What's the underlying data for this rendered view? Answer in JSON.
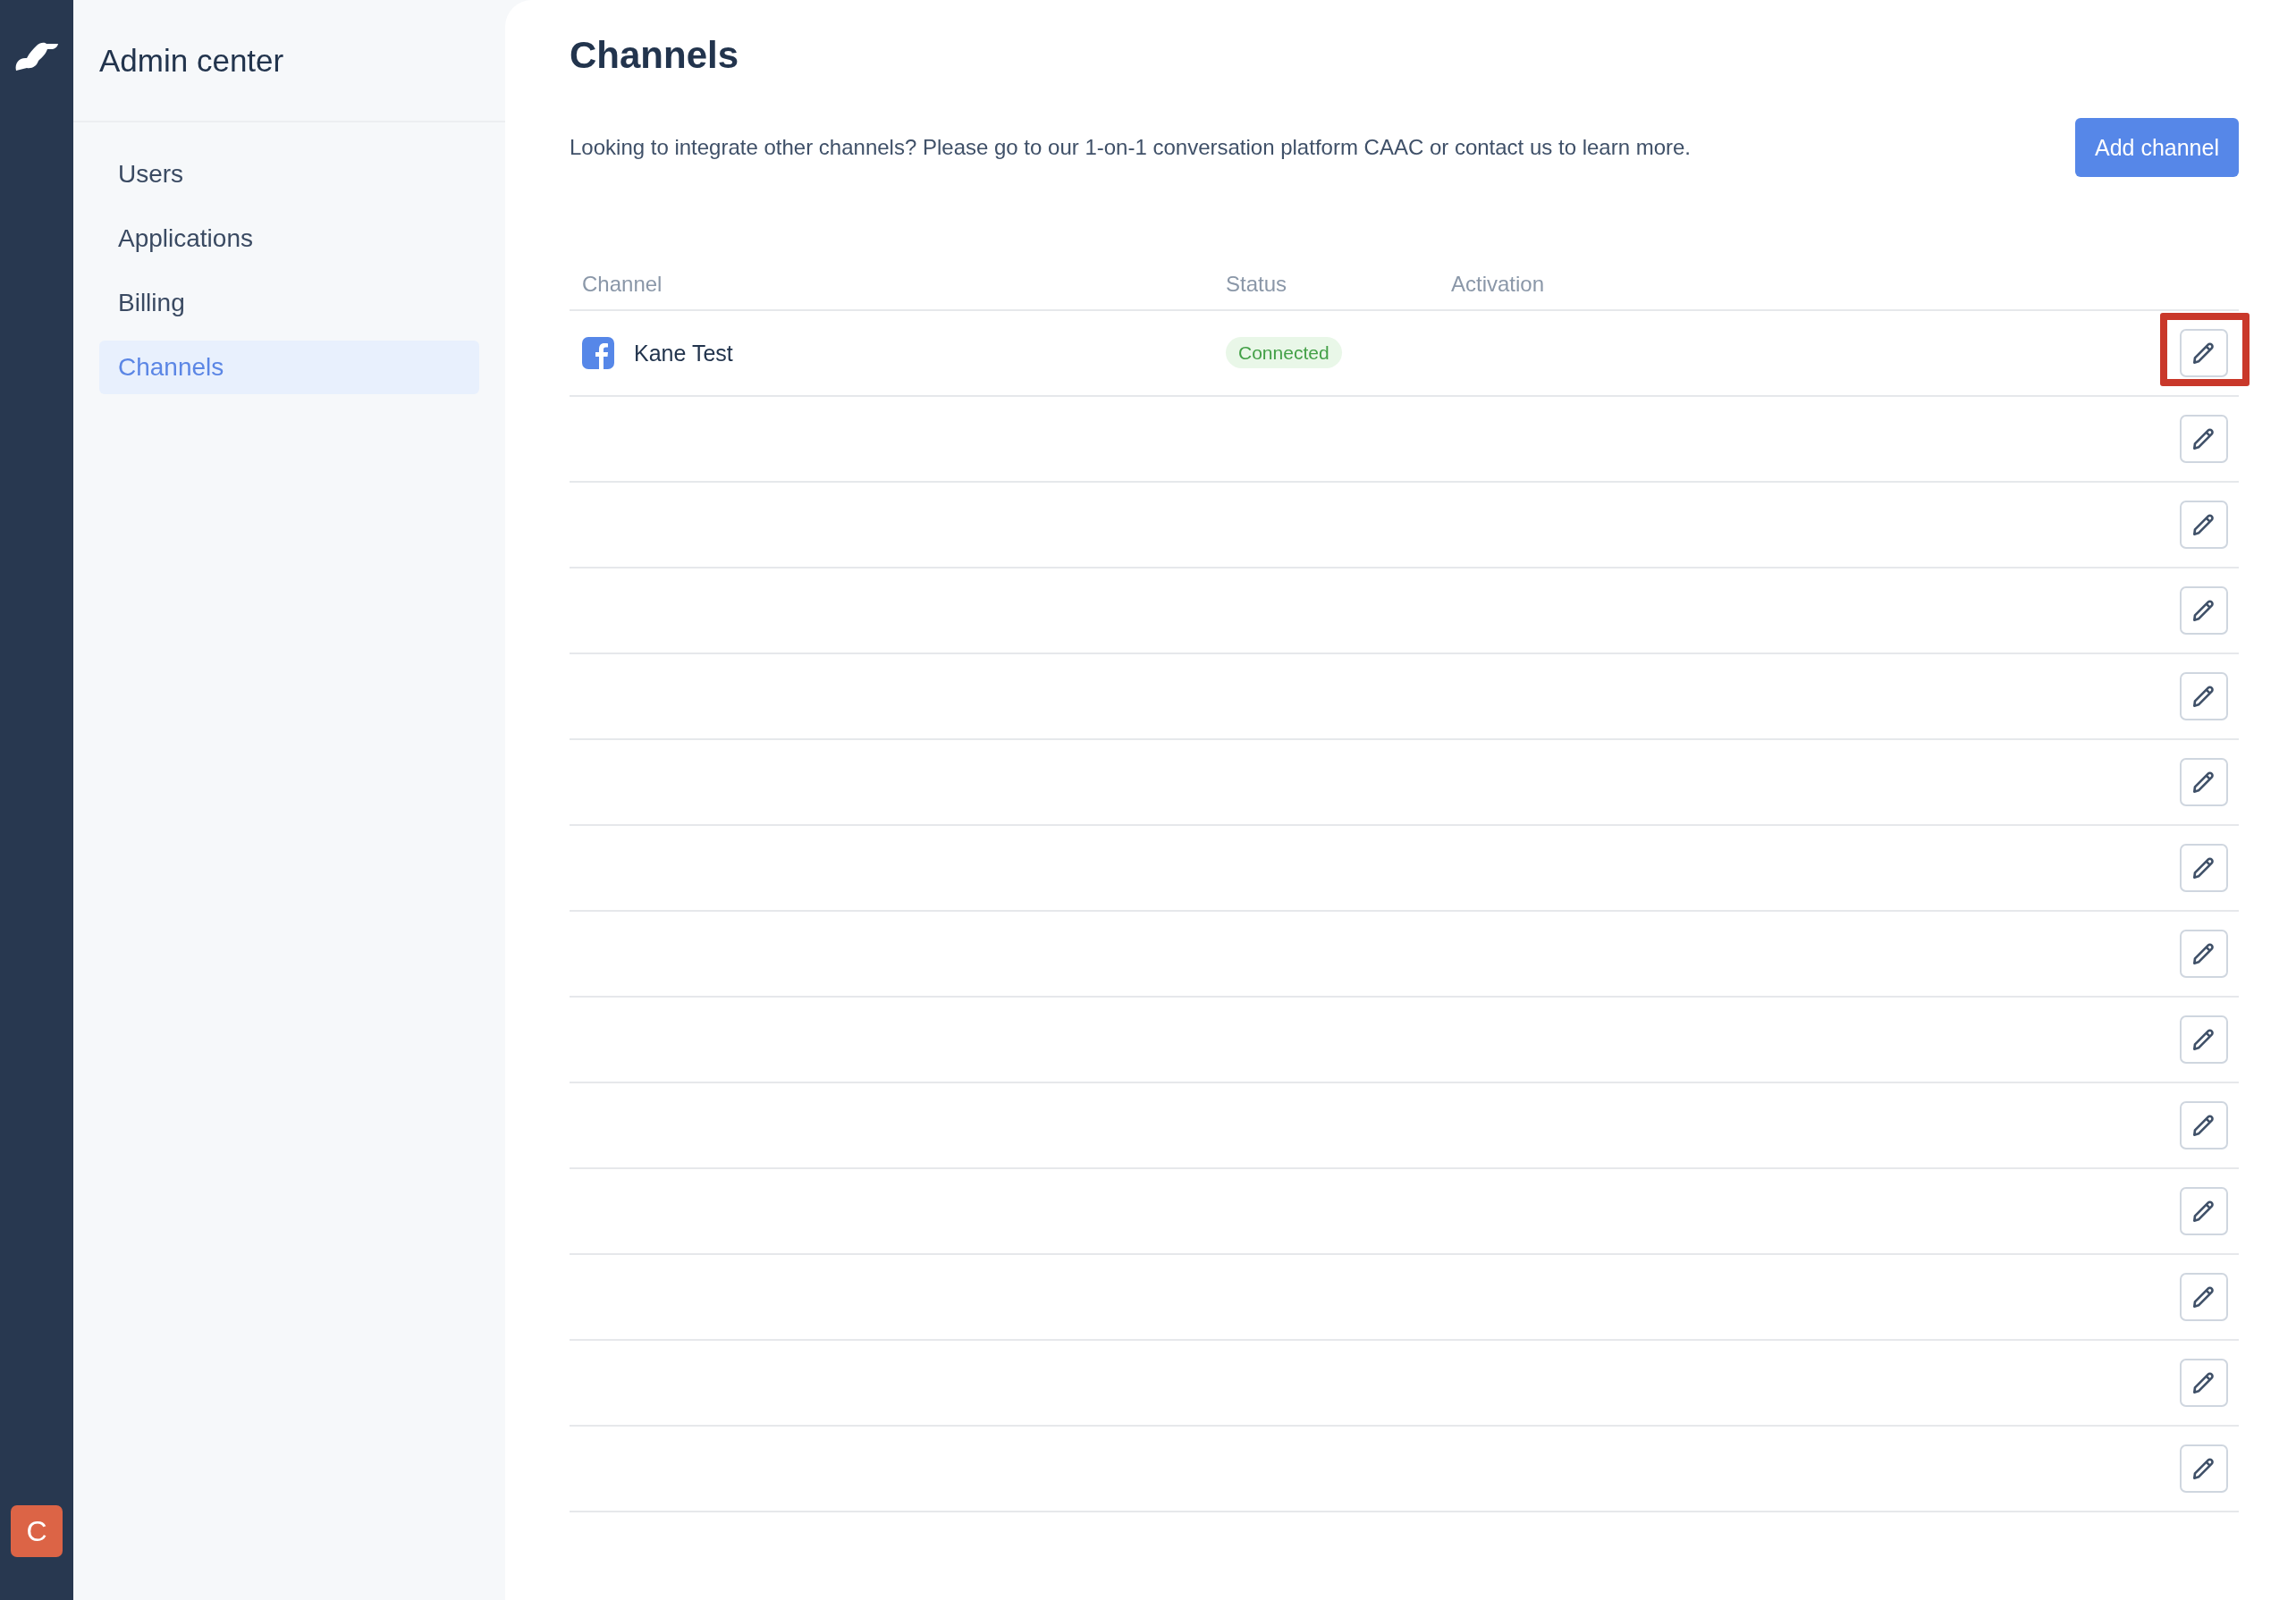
{
  "rail": {
    "avatar": "C"
  },
  "sidebar": {
    "title": "Admin center",
    "items": [
      {
        "label": "Users",
        "selected": false
      },
      {
        "label": "Applications",
        "selected": false
      },
      {
        "label": "Billing",
        "selected": false
      },
      {
        "label": "Channels",
        "selected": true
      }
    ]
  },
  "main": {
    "title": "Channels",
    "description": "Looking to integrate other channels? Please go to our 1-on-1 conversation platform CAAC or contact us to learn more.",
    "add_button": "Add channel"
  },
  "table": {
    "columns": [
      "Channel",
      "Status",
      "Activation"
    ],
    "rows": [
      {
        "channel": "Kane Test",
        "status": "Connected",
        "highlighted": true
      },
      {
        "highlighted": false
      },
      {
        "highlighted": false
      },
      {
        "highlighted": false
      },
      {
        "highlighted": false
      },
      {
        "highlighted": false
      },
      {
        "highlighted": false
      },
      {
        "highlighted": false
      },
      {
        "highlighted": false
      },
      {
        "highlighted": false
      },
      {
        "highlighted": false
      },
      {
        "highlighted": false
      },
      {
        "highlighted": false
      },
      {
        "highlighted": false
      }
    ]
  }
}
